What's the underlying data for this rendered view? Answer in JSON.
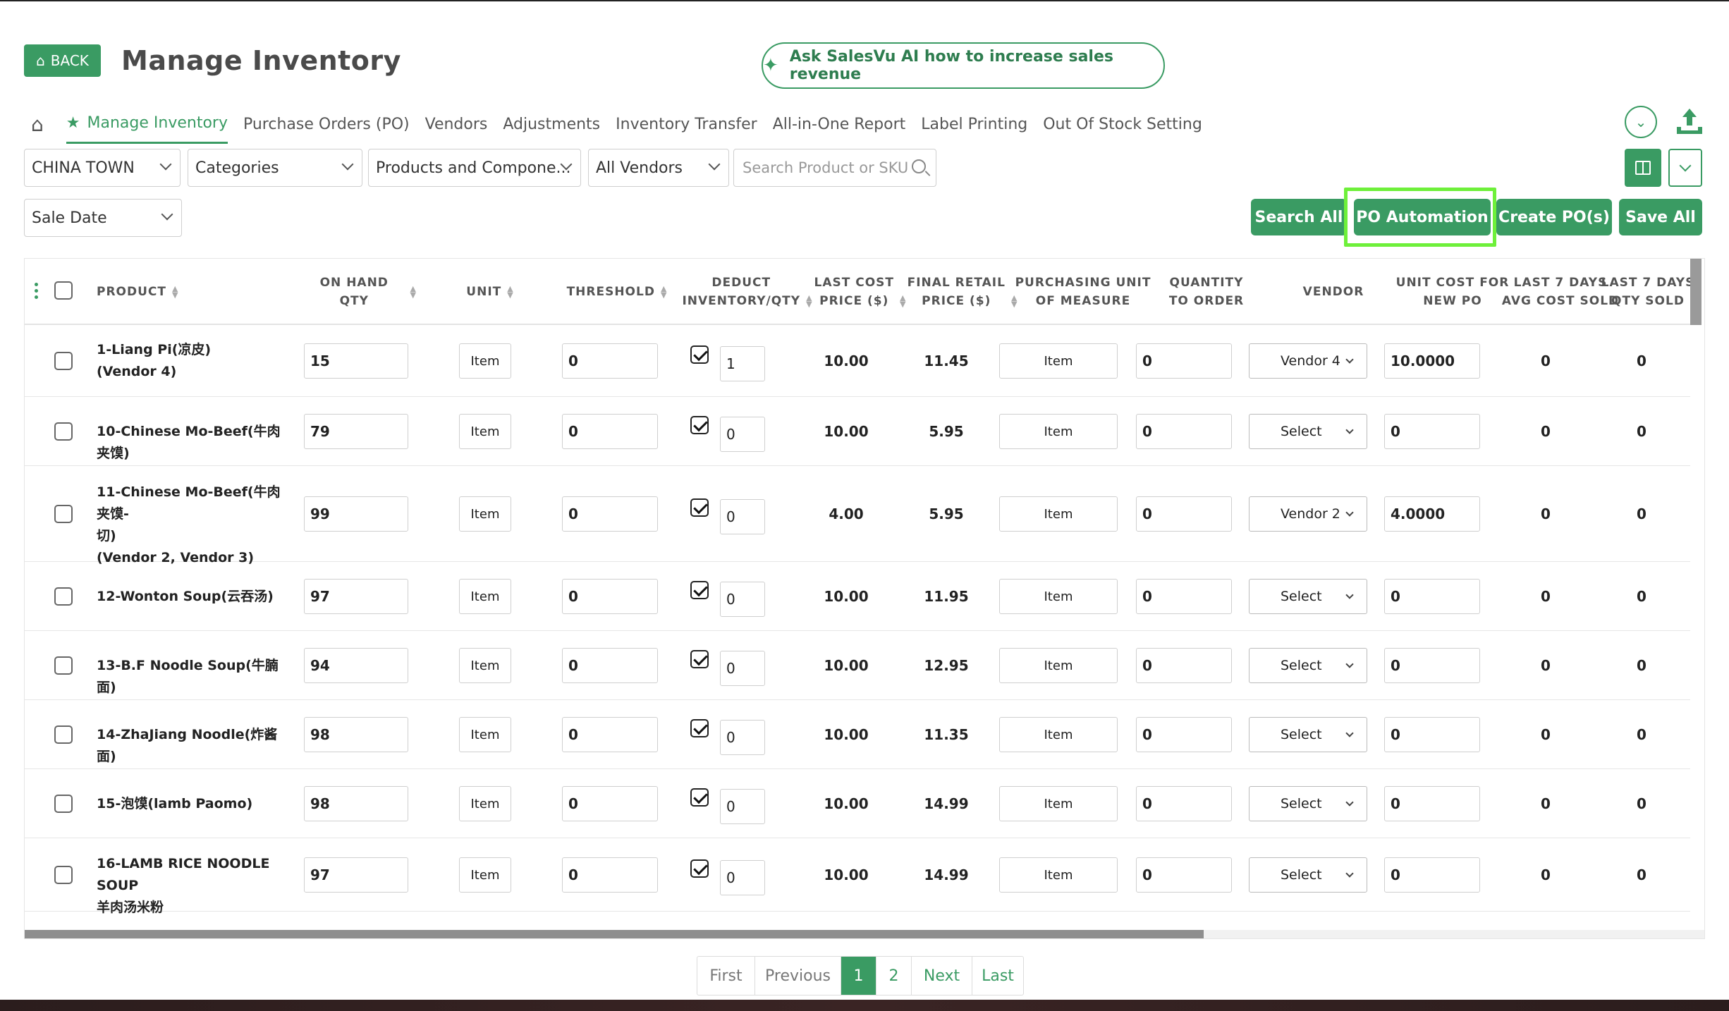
{
  "header": {
    "back_label": "BACK",
    "title": "Manage Inventory",
    "ai_prompt": "Ask SalesVu AI how to increase sales revenue"
  },
  "nav": {
    "tabs": [
      "Manage Inventory",
      "Purchase Orders (PO)",
      "Vendors",
      "Adjustments",
      "Inventory Transfer",
      "All-in-One Report",
      "Label Printing",
      "Out Of Stock Setting"
    ],
    "active_tab": "Manage Inventory"
  },
  "filters": {
    "location": "CHINA TOWN",
    "categories": "Categories",
    "product_type": "Products and Compone...",
    "vendors": "All Vendors",
    "search_placeholder": "Search Product or SKU",
    "date_type": "Sale Date"
  },
  "actions": {
    "search_all": "Search All",
    "po_automation": "PO Automation",
    "create_po": "Create PO(s)",
    "save_all": "Save All"
  },
  "table": {
    "headers": {
      "product": "PRODUCT",
      "on_hand": "ON HAND QTY",
      "unit": "UNIT",
      "threshold": "THRESHOLD",
      "deduct_1": "DEDUCT",
      "deduct_2": "INVENTORY/QTY",
      "last_cost_1": "LAST COST",
      "last_cost_2": "PRICE ($)",
      "retail_1": "FINAL RETAIL",
      "retail_2": "PRICE ($)",
      "pum_1": "PURCHASING UNIT",
      "pum_2": "OF MEASURE",
      "qto_1": "QUANTITY",
      "qto_2": "TO ORDER",
      "vendor": "VENDOR",
      "ucost_1": "UNIT COST FOR",
      "ucost_2": "NEW PO",
      "avg_1": "LAST 7 DAYS",
      "avg_2": "AVG COST SOLD",
      "qty7_1": "LAST 7 DAYS",
      "qty7_2": "QTY SOLD"
    },
    "rows": [
      {
        "name_1": "1-Liang Pi(凉皮)",
        "name_2": "(Vendor 4)",
        "name_3": "",
        "on_hand": "15",
        "unit": "Item",
        "threshold": "0",
        "deduct_qty": "1",
        "last_cost": "10.00",
        "retail": "11.45",
        "pum": "Item",
        "qto": "0",
        "vendor": "Vendor 4",
        "unit_cost": "10.0000",
        "avg_cost": "0",
        "qty_sold": "0"
      },
      {
        "name_1": "10-Chinese Mo-Beef(牛肉夹馍)",
        "name_2": "",
        "name_3": "",
        "on_hand": "79",
        "unit": "Item",
        "threshold": "0",
        "deduct_qty": "0",
        "last_cost": "10.00",
        "retail": "5.95",
        "pum": "Item",
        "qto": "0",
        "vendor": "Select",
        "unit_cost": "0",
        "avg_cost": "0",
        "qty_sold": "0"
      },
      {
        "name_1": "11-Chinese Mo-Beef(牛肉夹馍-",
        "name_2": "切)",
        "name_3": "(Vendor 2, Vendor 3)",
        "on_hand": "99",
        "unit": "Item",
        "threshold": "0",
        "deduct_qty": "0",
        "last_cost": "4.00",
        "retail": "5.95",
        "pum": "Item",
        "qto": "0",
        "vendor": "Vendor 2",
        "unit_cost": "4.0000",
        "avg_cost": "0",
        "qty_sold": "0"
      },
      {
        "name_1": "12-Wonton Soup(云吞汤)",
        "name_2": "",
        "name_3": "",
        "on_hand": "97",
        "unit": "Item",
        "threshold": "0",
        "deduct_qty": "0",
        "last_cost": "10.00",
        "retail": "11.95",
        "pum": "Item",
        "qto": "0",
        "vendor": "Select",
        "unit_cost": "0",
        "avg_cost": "0",
        "qty_sold": "0"
      },
      {
        "name_1": "13-B.F Noodle Soup(牛腩面)",
        "name_2": "",
        "name_3": "",
        "on_hand": "94",
        "unit": "Item",
        "threshold": "0",
        "deduct_qty": "0",
        "last_cost": "10.00",
        "retail": "12.95",
        "pum": "Item",
        "qto": "0",
        "vendor": "Select",
        "unit_cost": "0",
        "avg_cost": "0",
        "qty_sold": "0"
      },
      {
        "name_1": "14-ZhaJiang Noodle(炸酱面)",
        "name_2": "",
        "name_3": "",
        "on_hand": "98",
        "unit": "Item",
        "threshold": "0",
        "deduct_qty": "0",
        "last_cost": "10.00",
        "retail": "11.35",
        "pum": "Item",
        "qto": "0",
        "vendor": "Select",
        "unit_cost": "0",
        "avg_cost": "0",
        "qty_sold": "0"
      },
      {
        "name_1": "15-泡馍(lamb Paomo)",
        "name_2": "",
        "name_3": "",
        "on_hand": "98",
        "unit": "Item",
        "threshold": "0",
        "deduct_qty": "0",
        "last_cost": "10.00",
        "retail": "14.99",
        "pum": "Item",
        "qto": "0",
        "vendor": "Select",
        "unit_cost": "0",
        "avg_cost": "0",
        "qty_sold": "0"
      },
      {
        "name_1": "16-LAMB RICE NOODLE SOUP",
        "name_2": "羊肉汤米粉",
        "name_3": "",
        "on_hand": "97",
        "unit": "Item",
        "threshold": "0",
        "deduct_qty": "0",
        "last_cost": "10.00",
        "retail": "14.99",
        "pum": "Item",
        "qto": "0",
        "vendor": "Select",
        "unit_cost": "0",
        "avg_cost": "0",
        "qty_sold": "0"
      }
    ]
  },
  "pagination": {
    "first": "First",
    "previous": "Previous",
    "page_1": "1",
    "page_2": "2",
    "next": "Next",
    "last": "Last",
    "current": "1"
  },
  "colors": {
    "accent": "#3a9b63",
    "highlight": "#6ef03a"
  }
}
